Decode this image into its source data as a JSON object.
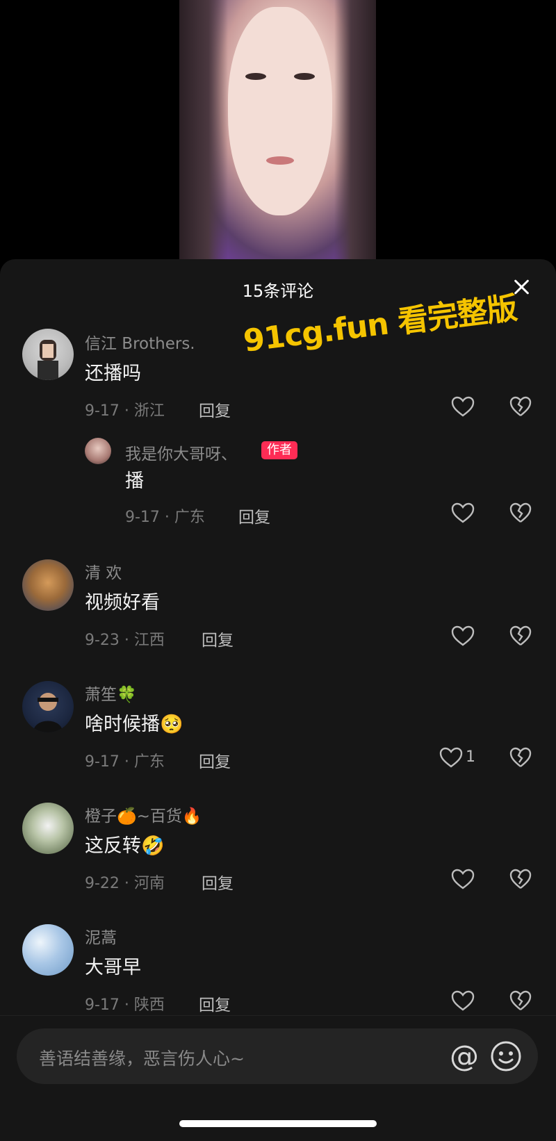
{
  "sheet": {
    "title": "15条评论"
  },
  "watermark": "91cg.fun 看完整版",
  "comments": [
    {
      "name": "信江 Brothers.",
      "text": "还播吗",
      "date": "9-17 · 浙江",
      "reply": "回复",
      "likes": ""
    },
    {
      "name": "我是你大哥呀、",
      "badge": "作者",
      "text": "播",
      "date": "9-17 · 广东",
      "reply": "回复",
      "likes": ""
    },
    {
      "name": "清 欢",
      "text": "视频好看",
      "date": "9-23 · 江西",
      "reply": "回复",
      "likes": ""
    },
    {
      "name": "萧笙🍀",
      "text": "啥时候播🥺",
      "date": "9-17 · 广东",
      "reply": "回复",
      "likes": "1"
    },
    {
      "name": "橙子🍊~百货🔥",
      "text": "这反转🤣",
      "date": "9-22 · 河南",
      "reply": "回复",
      "likes": ""
    },
    {
      "name": "泥蒿",
      "text": "大哥早",
      "date": "9-17 · 陕西",
      "reply": "回复",
      "likes": ""
    }
  ],
  "input": {
    "placeholder": "善语结善缘，恶言伤人心~",
    "at": "@"
  }
}
